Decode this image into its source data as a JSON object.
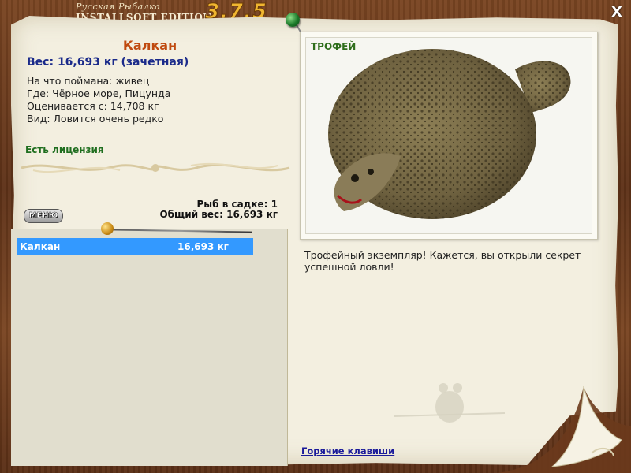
{
  "header": {
    "logo_small": "Русская Рыбалка",
    "logo_big": "INSTALLSOFT EDITION",
    "logo_version": "3.7.5",
    "close_label": "X"
  },
  "fish": {
    "name": "Калкан",
    "weight_line": "Вес: 16,693 кг (зачетная)",
    "bait_line": "На что поймана: живец",
    "place_line": "Где: Чёрное море, Пицунда",
    "rated_line": "Оценивается с: 14,708 кг",
    "kind_line": "Вид: Ловится очень редко",
    "license": "Есть лицензия"
  },
  "cage": {
    "count_line": "Рыб в садке: 1",
    "total_line": "Общий вес: 16,693 кг",
    "items": [
      {
        "name": "Калкан",
        "weight": "16,693 кг"
      }
    ]
  },
  "menu_label": "МЕНЮ",
  "photo": {
    "label": "ТРОФЕЙ"
  },
  "description": "Трофейный экземпляр! Кажется, вы открыли секрет успешной ловли!",
  "hotkeys_label": "Горячие клавиши",
  "colors": {
    "fish_name": "#c04a10",
    "weight": "#1a2a8a",
    "license": "#1f6e1f",
    "selection": "#3399ff",
    "trophy": "#2f6e1c"
  }
}
